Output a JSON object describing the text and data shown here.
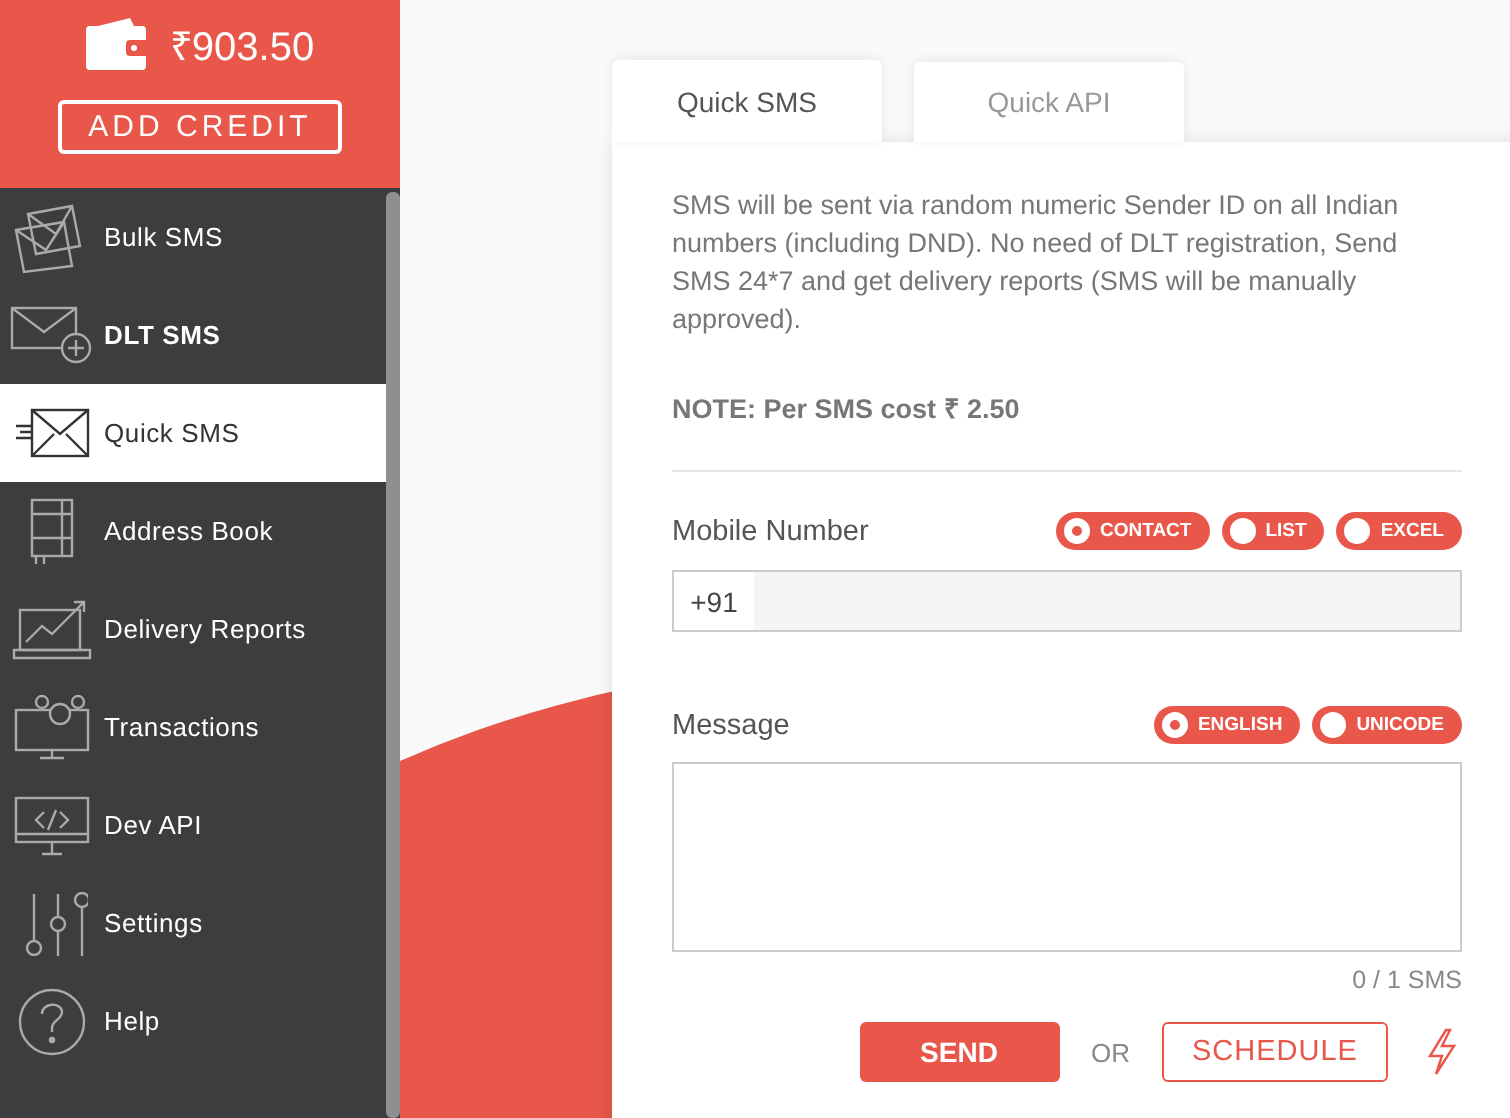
{
  "wallet": {
    "balance": "₹903.50",
    "button": "ADD CREDIT"
  },
  "nav": [
    {
      "label": "Bulk SMS",
      "selected": false,
      "bold": false
    },
    {
      "label": "DLT SMS",
      "selected": false,
      "bold": true
    },
    {
      "label": "Quick SMS",
      "selected": true,
      "bold": false
    },
    {
      "label": "Address Book",
      "selected": false,
      "bold": false
    },
    {
      "label": "Delivery Reports",
      "selected": false,
      "bold": false
    },
    {
      "label": "Transactions",
      "selected": false,
      "bold": false
    },
    {
      "label": "Dev API",
      "selected": false,
      "bold": false
    },
    {
      "label": "Settings",
      "selected": false,
      "bold": false
    },
    {
      "label": "Help",
      "selected": false,
      "bold": false
    }
  ],
  "tabs": [
    {
      "label": "Quick SMS",
      "selected": true
    },
    {
      "label": "Quick API",
      "selected": false
    }
  ],
  "description": "SMS will be sent via random numeric Sender ID on all Indian numbers (including DND). No need of DLT registration, Send SMS 24*7 and get delivery reports (SMS will be manually approved).",
  "note": "NOTE: Per SMS cost ₹ 2.50",
  "mobile": {
    "label": "Mobile Number",
    "prefix": "+91",
    "options": [
      {
        "label": "CONTACT",
        "selected": true
      },
      {
        "label": "LIST",
        "selected": false
      },
      {
        "label": "EXCEL",
        "selected": false
      }
    ]
  },
  "message": {
    "label": "Message",
    "counter": "0 / 1 SMS",
    "options": [
      {
        "label": "ENGLISH",
        "selected": true
      },
      {
        "label": "UNICODE",
        "selected": false
      }
    ]
  },
  "actions": {
    "send": "SEND",
    "or": "OR",
    "schedule": "SCHEDULE"
  }
}
